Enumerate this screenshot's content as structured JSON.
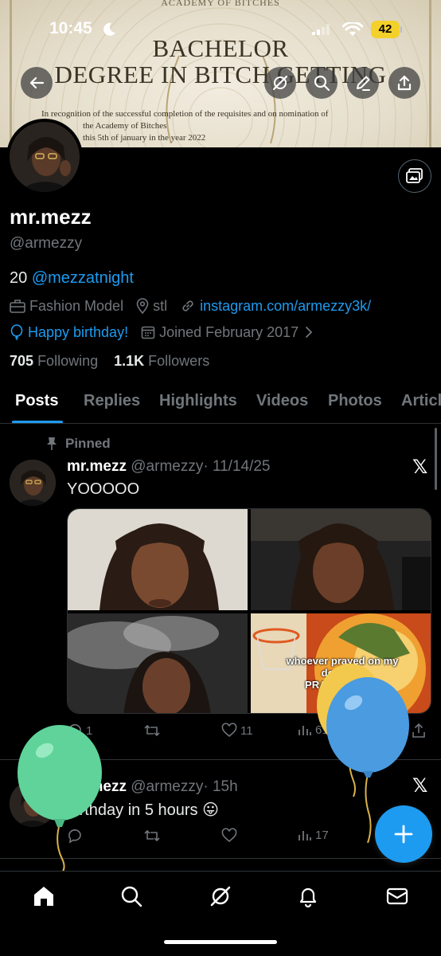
{
  "status_bar": {
    "time": "10:45",
    "battery": "42"
  },
  "banner": {
    "top_text": "ACADEMY OF BITCHES",
    "title_line1": "BACHELOR",
    "title_line2": "DEGREE IN BITCH GETTING",
    "body_line1": "In recognition of the successful completion of the requisites and on nomination of",
    "body_line2": "the Academy of Bitches",
    "body_line3": "this 5th of january in the year 2022"
  },
  "profile": {
    "display_name": "mr.mezz",
    "handle": "@armezzy",
    "bio_prefix": "20",
    "bio_mention": "@mezzatnight",
    "profession": "Fashion Model",
    "location": "stl",
    "website": "instagram.com/armezzy3k/",
    "birthday": "Happy birthday!",
    "joined": "Joined February 2017",
    "following_count": "705",
    "following_label": "Following",
    "followers_count": "1.1K",
    "followers_label": "Followers"
  },
  "tabs": [
    "Posts",
    "Replies",
    "Highlights",
    "Videos",
    "Photos",
    "Articles"
  ],
  "active_tab": "Posts",
  "posts": [
    {
      "pinned_label": "Pinned",
      "author": "mr.mezz",
      "handle": "@armezzy",
      "date": "· 11/14/25",
      "text": "YOOOOO",
      "meme_text_1": "whoever prayed on my",
      "meme_text_2": "downfall",
      "meme_text_3": "PRAY HARDER",
      "replies": "1",
      "reposts": "",
      "likes": "11",
      "views": "61"
    },
    {
      "author": "mr.mezz",
      "handle": "@armezzy",
      "date": "· 15h",
      "text": "birthday in 5 hours 😛",
      "replies": "",
      "reposts": "",
      "likes": "",
      "views": "17"
    }
  ],
  "icons": {
    "back": "arrow-left-icon",
    "grok": "grok-icon",
    "search": "search-icon",
    "edit": "pencil-icon",
    "share": "share-icon",
    "compose": "plus-icon"
  },
  "colors": {
    "accent": "#1d9bf0",
    "balloon_green": "#5fd39a",
    "balloon_blue": "#4a9be0",
    "balloon_yellow": "#f2c94c"
  }
}
